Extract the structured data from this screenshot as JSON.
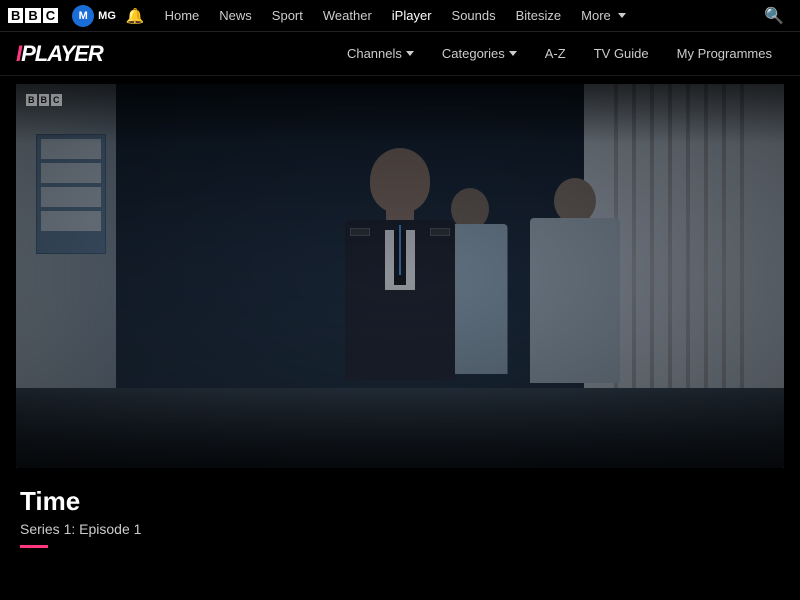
{
  "topnav": {
    "bbc_blocks": [
      "B",
      "B",
      "C"
    ],
    "user_icon": "M",
    "user_initials": "MG",
    "links": [
      {
        "label": "Home",
        "id": "home"
      },
      {
        "label": "News",
        "id": "news"
      },
      {
        "label": "Sport",
        "id": "sport"
      },
      {
        "label": "Weather",
        "id": "weather"
      },
      {
        "label": "iPlayer",
        "id": "iplayer"
      },
      {
        "label": "Sounds",
        "id": "sounds"
      },
      {
        "label": "Bitesize",
        "id": "bitesize"
      },
      {
        "label": "More",
        "id": "more"
      }
    ]
  },
  "iplayer_header": {
    "logo_prefix": "i",
    "logo_suffix": "PLAYER",
    "nav": [
      {
        "label": "Channels",
        "has_dropdown": true
      },
      {
        "label": "Categories",
        "has_dropdown": true
      },
      {
        "label": "A-Z",
        "has_dropdown": false
      },
      {
        "label": "TV Guide",
        "has_dropdown": false
      },
      {
        "label": "My Programmes",
        "has_dropdown": false
      }
    ]
  },
  "video": {
    "bbc_logo_blocks": [
      "B",
      "B",
      "C"
    ]
  },
  "program": {
    "title": "Time",
    "subtitle": "Series 1: Episode 1"
  }
}
